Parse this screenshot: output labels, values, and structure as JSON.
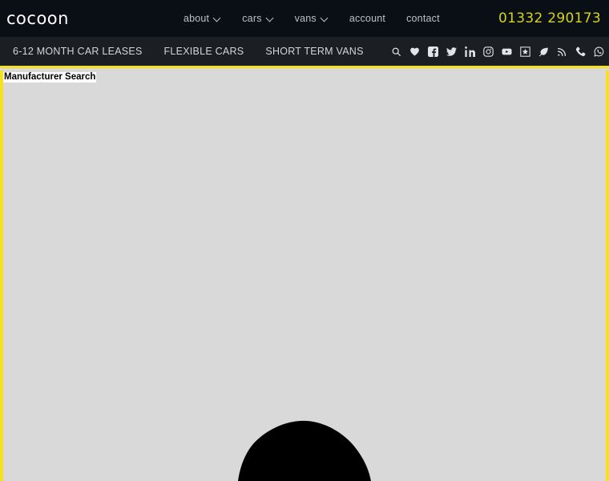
{
  "site": {
    "logo_text": "cocoon",
    "phone": "01332 290173",
    "accent_yellow": "#f5e11e",
    "phone_color": "#d7d416",
    "topbar_bg": "#0a0e15",
    "subbar_bg": "#1b1e23",
    "content_bg": "#d9d9d9"
  },
  "topnav": {
    "items": [
      {
        "label": "about",
        "has_caret": true
      },
      {
        "label": "cars",
        "has_caret": true
      },
      {
        "label": "vans",
        "has_caret": true
      },
      {
        "label": "account",
        "has_caret": false
      },
      {
        "label": "contact",
        "has_caret": false
      }
    ]
  },
  "subnav": {
    "items": [
      {
        "label": "6-12 MONTH CAR LEASES"
      },
      {
        "label": "FLEXIBLE CARS"
      },
      {
        "label": "SHORT TERM VANS"
      }
    ],
    "social_icons": [
      {
        "name": "search-icon",
        "title": "Search"
      },
      {
        "name": "heart-icon",
        "title": "Favourites"
      },
      {
        "name": "facebook-icon",
        "title": "Facebook"
      },
      {
        "name": "twitter-icon",
        "title": "Twitter"
      },
      {
        "name": "linkedin-icon",
        "title": "LinkedIn"
      },
      {
        "name": "instagram-icon",
        "title": "Instagram"
      },
      {
        "name": "youtube-icon",
        "title": "YouTube"
      },
      {
        "name": "trustpilot-icon",
        "title": "Trustpilot"
      },
      {
        "name": "leaf-icon",
        "title": "Eco"
      },
      {
        "name": "rss-icon",
        "title": "RSS Feed"
      },
      {
        "name": "phone-icon",
        "title": "Call us"
      },
      {
        "name": "whatsapp-icon",
        "title": "WhatsApp"
      }
    ]
  },
  "content": {
    "panel_title": "Manufacturer Search"
  }
}
